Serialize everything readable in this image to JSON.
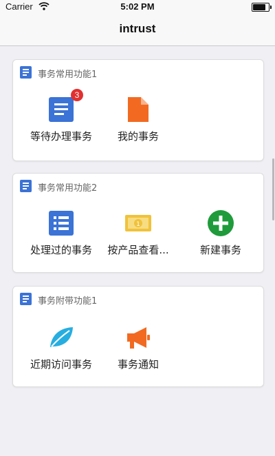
{
  "status_bar": {
    "carrier": "Carrier",
    "time": "5:02 PM",
    "battery_level": 0.92
  },
  "nav": {
    "title": "intrust"
  },
  "colors": {
    "doc_icon": "#3b73d6",
    "badge": "#e23030",
    "orange": "#f26a21",
    "green": "#1f9b3b",
    "yellow": "#f0c23a",
    "cyan": "#27aee0"
  },
  "cards": [
    {
      "title": "事务常用功能1",
      "items": [
        {
          "label": "等待办理事务",
          "icon": "list-doc-icon",
          "badge": "3"
        },
        {
          "label": "我的事务",
          "icon": "file-icon"
        }
      ]
    },
    {
      "title": "事务常用功能2",
      "items": [
        {
          "label": "处理过的事务",
          "icon": "checklist-icon"
        },
        {
          "label": "按产品查看...",
          "icon": "banknote-icon"
        },
        {
          "label": "新建事务",
          "icon": "plus-circle-icon"
        }
      ]
    },
    {
      "title": "事务附带功能1",
      "items": [
        {
          "label": "近期访问事务",
          "icon": "leaf-icon"
        },
        {
          "label": "事务通知",
          "icon": "megaphone-icon"
        }
      ]
    }
  ]
}
